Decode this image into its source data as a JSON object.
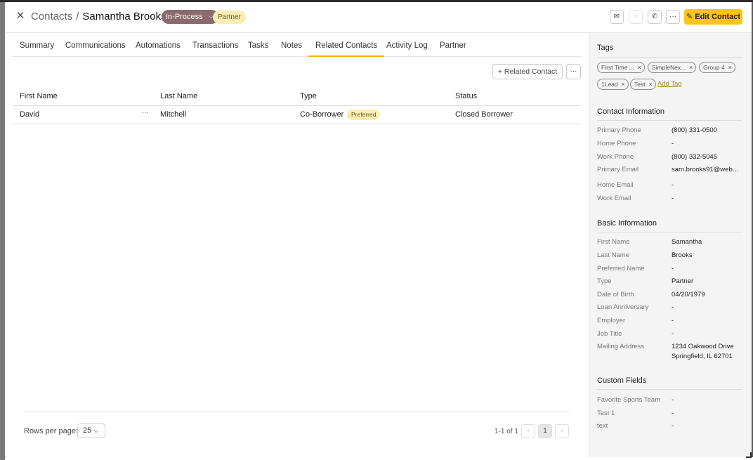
{
  "header": {
    "breadcrumb_root": "Contacts",
    "breadcrumb_sep": "/",
    "contact_name": "Samantha Brooks",
    "status": "In-Process",
    "type_badge": "Partner",
    "edit_label": "Edit Contact"
  },
  "tabs": [
    "Summary",
    "Communications",
    "Automations",
    "Transactions",
    "Tasks",
    "Notes",
    "Related Contacts",
    "Activity Log",
    "Partner"
  ],
  "active_tab": "Related Contacts",
  "related": {
    "add_label": "Related Contact",
    "columns": [
      "First Name",
      "Last Name",
      "Type",
      "Status"
    ],
    "rows": [
      {
        "first": "David",
        "last": "Mitchell",
        "type": "Co-Borrower",
        "badge": "Preferred",
        "status": "Closed Borrower"
      }
    ]
  },
  "pagination": {
    "rows_label": "Rows per page:",
    "rows_value": "25",
    "range": "1-1 of 1",
    "current": "1"
  },
  "sidebar": {
    "tags_title": "Tags",
    "tags": [
      "First Time ...",
      "SimpleNex...",
      "Group 4",
      "1Lead",
      "Test"
    ],
    "add_tag": "Add Tag",
    "contact_title": "Contact Information",
    "contact": [
      {
        "k": "Primary Phone",
        "v": "(800) 331-0500"
      },
      {
        "k": "Home Phone",
        "v": "-"
      },
      {
        "k": "Work Phone",
        "v": "(800) 332-5045"
      },
      {
        "k": "Primary Email",
        "v": "sam.brooks91@webm..."
      },
      {
        "k": "Home Email",
        "v": "-"
      },
      {
        "k": "Work Email",
        "v": "-"
      }
    ],
    "basic_title": "Basic Information",
    "basic": [
      {
        "k": "First Name",
        "v": "Samantha"
      },
      {
        "k": "Last Name",
        "v": "Brooks"
      },
      {
        "k": "Preferred Name",
        "v": "-"
      },
      {
        "k": "Type",
        "v": "Partner"
      },
      {
        "k": "Date of Birth",
        "v": "04/20/1979"
      },
      {
        "k": "Loan Anniversary",
        "v": "-"
      },
      {
        "k": "Employer",
        "v": "-"
      },
      {
        "k": "Job Title",
        "v": "-"
      }
    ],
    "address_label": "Mailing Address",
    "address_line1": "1234 Oakwood Drive",
    "address_line2": "Springfield, IL 62701",
    "custom_title": "Custom Fields",
    "custom": [
      {
        "k": "Favorite Sports Team",
        "v": "-"
      },
      {
        "k": "Test 1",
        "v": "-"
      },
      {
        "k": "text",
        "v": "-"
      }
    ]
  }
}
